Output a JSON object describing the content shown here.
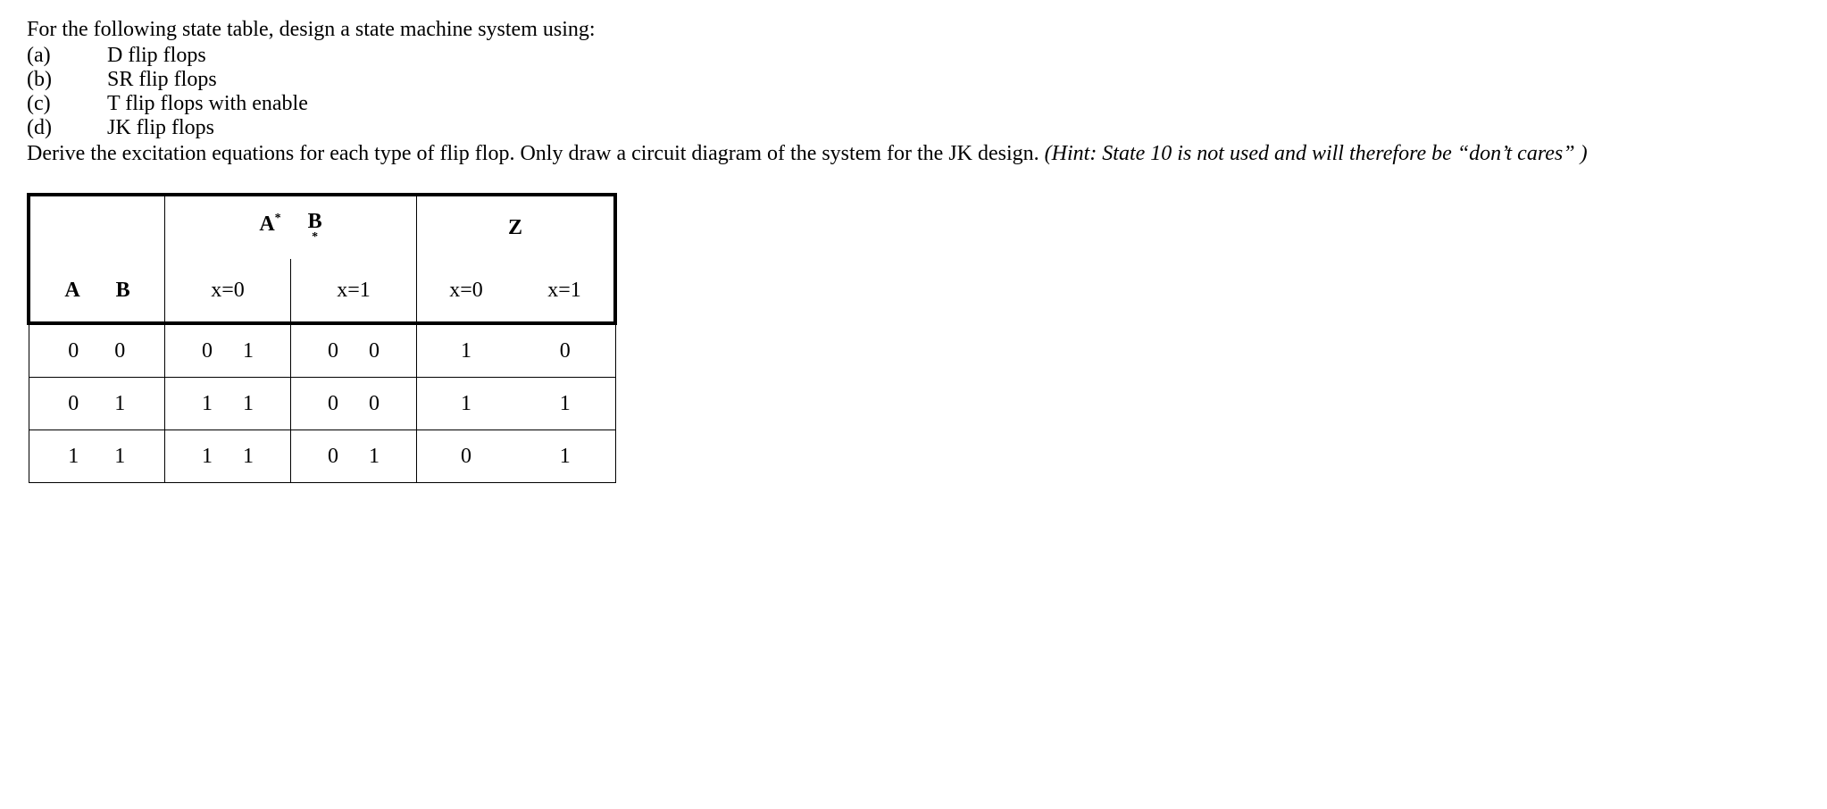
{
  "intro": "For the following state table, design a state machine system using:",
  "options": [
    {
      "label": "(a)",
      "text": "D flip flops"
    },
    {
      "label": "(b)",
      "text": "SR flip flops"
    },
    {
      "label": "(c)",
      "text": "T flip flops with enable"
    },
    {
      "label": "(d)",
      "text": "JK flip flops"
    }
  ],
  "derive_part1": "Derive the excitation equations for each type of flip flop.   Only draw a circuit diagram of the system for the JK design.   ",
  "derive_hint": "(Hint: State 10 is not used and will therefore be “don’t cares” )",
  "table": {
    "header_top": {
      "ns_A": "A",
      "ns_A_sup": "*",
      "ns_B": "B",
      "ns_B_sub": "*",
      "Z": "Z"
    },
    "header_bottom": {
      "A": "A",
      "B": "B",
      "x0": "x=0",
      "x1": "x=1",
      "zx0": "x=0",
      "zx1": "x=1"
    },
    "rows": [
      {
        "A": "0",
        "B": "0",
        "ns_x0_A": "0",
        "ns_x0_B": "1",
        "ns_x1_A": "0",
        "ns_x1_B": "0",
        "z_x0": "1",
        "z_x1": "0"
      },
      {
        "A": "0",
        "B": "1",
        "ns_x0_A": "1",
        "ns_x0_B": "1",
        "ns_x1_A": "0",
        "ns_x1_B": "0",
        "z_x0": "1",
        "z_x1": "1"
      },
      {
        "A": "1",
        "B": "1",
        "ns_x0_A": "1",
        "ns_x0_B": "1",
        "ns_x1_A": "0",
        "ns_x1_B": "1",
        "z_x0": "0",
        "z_x1": "1"
      }
    ]
  }
}
